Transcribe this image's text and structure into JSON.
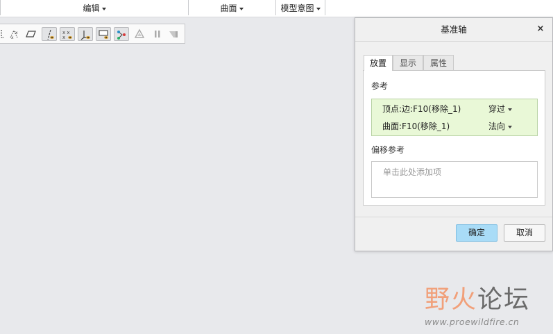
{
  "ribbon": {
    "groups": [
      {
        "label": "编辑"
      },
      {
        "label": "曲面"
      },
      {
        "label": "模型意图"
      }
    ]
  },
  "toolbar": {
    "icons": [
      "corner-icon",
      "scatter-points-icon",
      "plane-icon",
      "axis-display-icon",
      "point-display-icon",
      "csys-display-icon",
      "plane-display-icon",
      "annotation-display-icon",
      "spin-center-icon",
      "pause-icon",
      "resume-icon"
    ]
  },
  "dialog": {
    "title": "基准轴",
    "close_glyph": "×",
    "tabs": [
      {
        "label": "放置",
        "active": true
      },
      {
        "label": "显示",
        "active": false
      },
      {
        "label": "属性",
        "active": false
      }
    ],
    "references_label": "参考",
    "references": [
      {
        "ref": "顶点:边:F10(移除_1)",
        "mode": "穿过"
      },
      {
        "ref": "曲面:F10(移除_1)",
        "mode": "法向"
      }
    ],
    "offset_label": "偏移参考",
    "offset_placeholder": "单击此处添加项",
    "ok_label": "确定",
    "cancel_label": "取消"
  },
  "watermark": {
    "logo_part1": "野火",
    "logo_part2": "论坛",
    "url": "www.proewildfire.cn"
  },
  "colors": {
    "accent_button": "#a9dcf7",
    "reference_list_bg": "#e9f8d7",
    "logo_orange": "#f1a07a"
  }
}
